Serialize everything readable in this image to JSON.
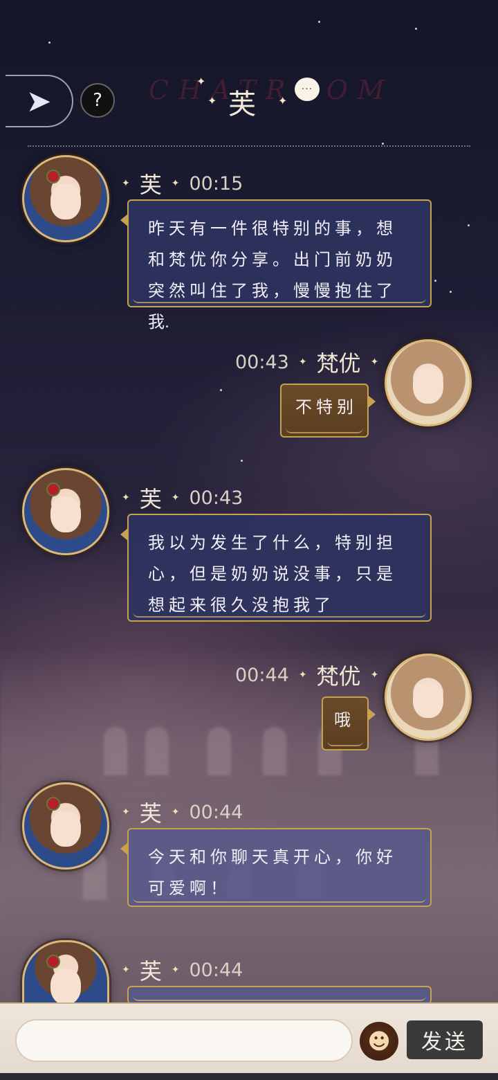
{
  "header": {
    "watermark": "CHATROOM",
    "title": "芙",
    "back_icon": "back-arrow-icon",
    "help_label": "?",
    "chat_icon_label": "···"
  },
  "messages": [
    {
      "side": "left",
      "speaker": "芙",
      "time": "00:15",
      "text": "昨天有一件很特别的事，想和梵优你分享。出门前奶奶突然叫住了我，慢慢抱住了我"
    },
    {
      "side": "right",
      "speaker": "梵优",
      "time": "00:43",
      "text": "不特别"
    },
    {
      "side": "left",
      "speaker": "芙",
      "time": "00:43",
      "text": "我以为发生了什么，特别担心，但是奶奶说没事，只是想起来很久没抱我了"
    },
    {
      "side": "right",
      "speaker": "梵优",
      "time": "00:44",
      "text": "哦"
    },
    {
      "side": "left",
      "speaker": "芙",
      "time": "00:44",
      "text": "今天和你聊天真开心，你好可爱啊！"
    },
    {
      "side": "left",
      "speaker": "芙",
      "time": "00:44",
      "text": ""
    }
  ],
  "inputbar": {
    "placeholder": "",
    "emoji_icon": "smiley-icon",
    "send_label": "发送"
  },
  "colors": {
    "gold": "#c9a24f",
    "left_bubble": "#2e3360",
    "right_bubble": "#6a4b28",
    "send_button": "#3b3a3a"
  }
}
